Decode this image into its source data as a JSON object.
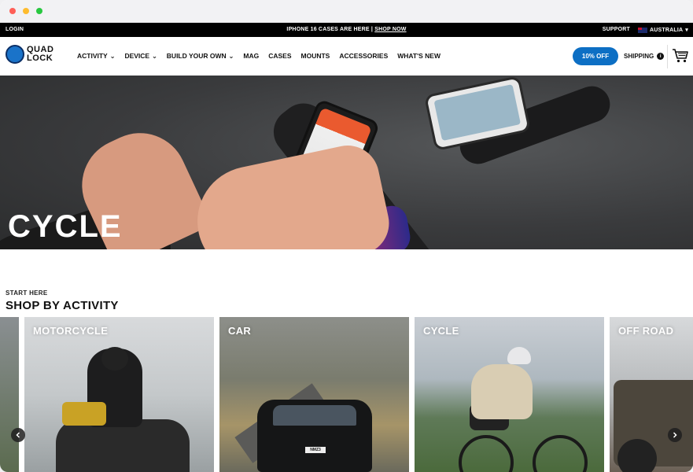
{
  "promo": {
    "login": "LOGIN",
    "announcement": "IPHONE 16 CASES ARE HERE",
    "separator": "|",
    "shop_now": "SHOP NOW",
    "support": "SUPPORT",
    "region": "AUSTRALIA"
  },
  "brand": {
    "line1": "QUAD",
    "line2": "LOCK",
    "color": "#1a73c9"
  },
  "nav": {
    "items": [
      {
        "label": "ACTIVITY",
        "dropdown": true
      },
      {
        "label": "DEVICE",
        "dropdown": true
      },
      {
        "label": "BUILD YOUR OWN",
        "dropdown": true
      },
      {
        "label": "MAG",
        "dropdown": false
      },
      {
        "label": "CASES",
        "dropdown": false
      },
      {
        "label": "MOUNTS",
        "dropdown": false
      },
      {
        "label": "ACCESSORIES",
        "dropdown": false
      },
      {
        "label": "WHAT'S NEW",
        "dropdown": false
      }
    ],
    "discount_label": "10% OFF",
    "shipping_label": "SHIPPING",
    "accent_color": "#0d6fc4"
  },
  "hero": {
    "title": "CYCLE"
  },
  "section": {
    "kicker": "START HERE",
    "title": "SHOP BY ACTIVITY"
  },
  "activities": [
    {
      "label": "MOTORCYCLE"
    },
    {
      "label": "CAR"
    },
    {
      "label": "CYCLE"
    },
    {
      "label": "OFF ROAD"
    }
  ],
  "car_plate": "NMZ3"
}
